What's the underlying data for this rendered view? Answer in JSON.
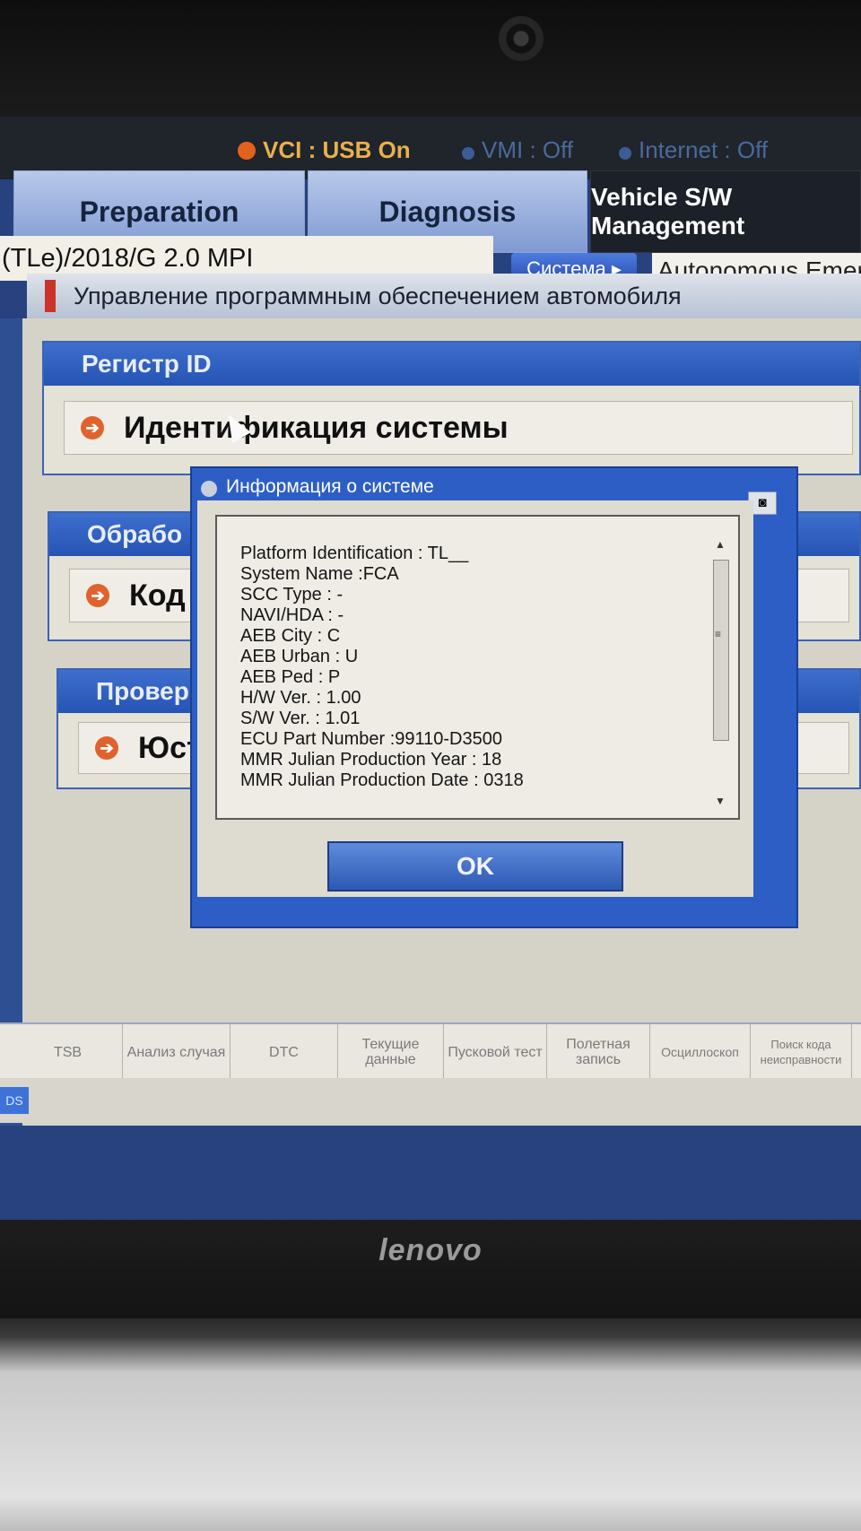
{
  "status_bar": {
    "vci": "VCI : USB On",
    "vmi": "VMI : Off",
    "internet": "Internet : Off"
  },
  "tabs": [
    {
      "label": "Preparation"
    },
    {
      "label": "Diagnosis"
    },
    {
      "label": "Vehicle S/W Management",
      "active": true
    }
  ],
  "vehicle": "(TLe)/2018/G 2.0 MPI",
  "system_button": "Система",
  "system_field": "Autonomous Emerg",
  "panel_title": "Управление программным обеспечением автомобиля",
  "sections": [
    {
      "header": "Регистр ID",
      "item": "Идентификация системы"
    },
    {
      "header": "Обрабо",
      "item": "Код"
    },
    {
      "header": "Провер",
      "item": "Юст"
    }
  ],
  "dialog": {
    "title": "Информация о системе",
    "lines": [
      "Platform Identification : TL__",
      "System Name :FCA",
      "SCC Type : -",
      "NAVI/HDA : -",
      "AEB City : C",
      "AEB Urban : U",
      "AEB Ped : P",
      "H/W Ver. : 1.00",
      "S/W Ver. : 1.01",
      "ECU Part Number :99110-D3500",
      "MMR Julian Production Year : 18",
      "MMR Julian Production Date : 0318"
    ],
    "ok_label": "OK"
  },
  "toolbar": [
    {
      "label": "TSB"
    },
    {
      "label": "Анализ случая"
    },
    {
      "label": "DTC"
    },
    {
      "label": "Текущие данные"
    },
    {
      "label": "Пусковой тест"
    },
    {
      "label": "Полетная запись"
    },
    {
      "label": "Осциллоскоп"
    },
    {
      "label": "Поиск кода неисправности"
    }
  ],
  "footer_badge": "DS",
  "laptop_logo": "lenovo",
  "colors": {
    "accent_blue": "#2d5ec5",
    "vci_status": "#e8b14a",
    "arrow_orange": "#e0622c"
  }
}
